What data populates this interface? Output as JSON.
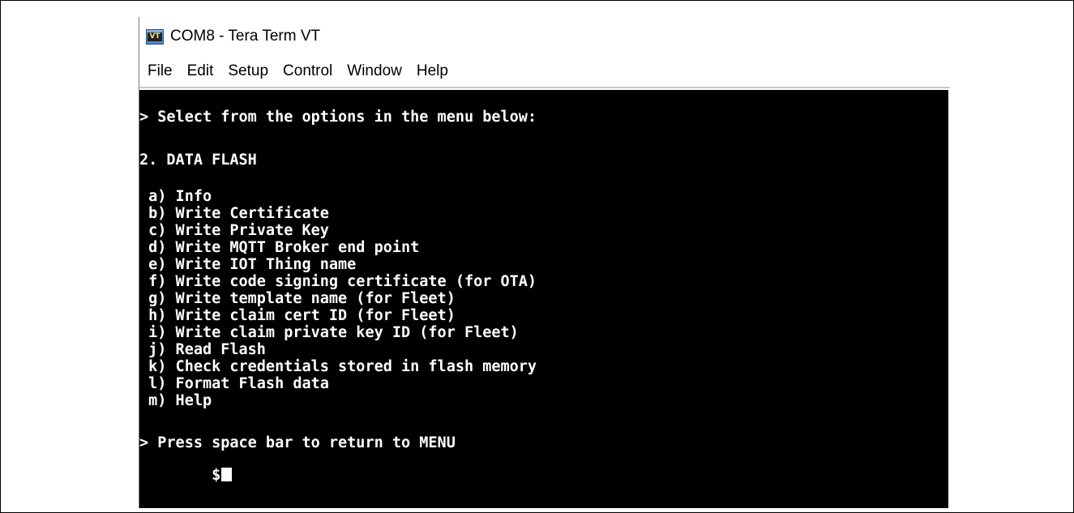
{
  "window": {
    "title": "COM8 - Tera Term VT",
    "icon": "tera-term-vt-icon",
    "icon_text": "VT"
  },
  "menu": [
    "File",
    "Edit",
    "Setup",
    "Control",
    "Window",
    "Help"
  ],
  "terminal": {
    "prompt_line": "> Select from the options in the menu below:",
    "section_title": "2. DATA FLASH",
    "options": [
      " a) Info",
      " b) Write Certificate",
      " c) Write Private Key",
      " d) Write MQTT Broker end point",
      " e) Write IOT Thing name",
      " f) Write code signing certificate (for OTA)",
      " g) Write template name (for Fleet)",
      " h) Write claim cert ID (for Fleet)",
      " i) Write claim private key ID (for Fleet)",
      " j) Read Flash",
      " k) Check credentials stored in flash memory",
      " l) Format Flash data",
      " m) Help"
    ],
    "return_line": "> Press space bar to return to MENU",
    "input_prompt": "$"
  }
}
